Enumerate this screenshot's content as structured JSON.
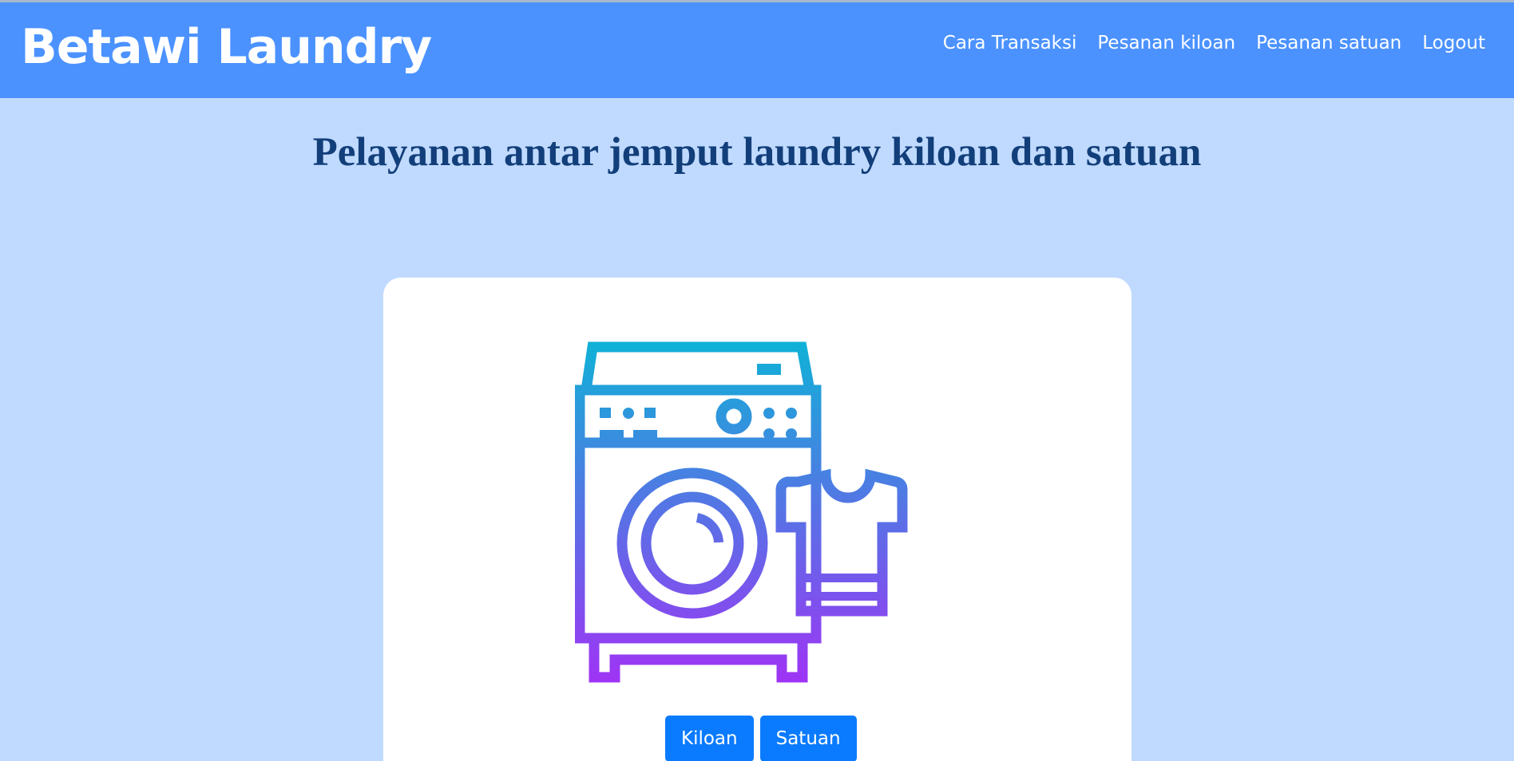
{
  "navbar": {
    "brand": "Betawi Laundry",
    "links": [
      {
        "label": "Cara Transaksi"
      },
      {
        "label": "Pesanan kiloan"
      },
      {
        "label": "Pesanan satuan"
      },
      {
        "label": "Logout"
      }
    ]
  },
  "main": {
    "headline": "Pelayanan antar jemput laundry kiloan dan satuan",
    "illustration_icon": "washing-machine-with-shirt-icon",
    "buttons": {
      "kiloan": "Kiloan",
      "satuan": "Satuan"
    }
  },
  "colors": {
    "page_background": "#c0daff",
    "navbar_background": "#4b92ff",
    "headline_text": "#123f7a",
    "button_primary": "#0a7bff",
    "icon_gradient_top": "#0fb2d6",
    "icon_gradient_bottom": "#a033f5"
  }
}
